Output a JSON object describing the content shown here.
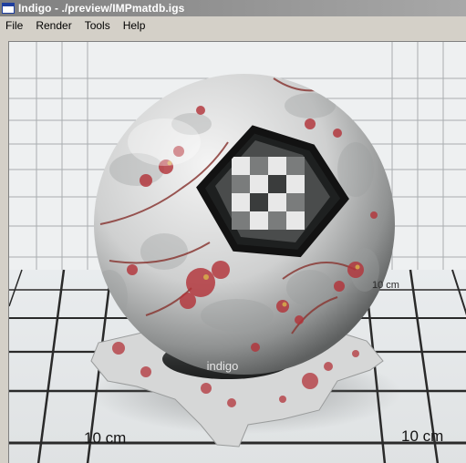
{
  "window": {
    "title": "Indigo - ./preview/IMPmatdb.igs",
    "icon": "app-window-icon"
  },
  "menu": {
    "items": [
      {
        "label": "File"
      },
      {
        "label": "Render"
      },
      {
        "label": "Tools"
      },
      {
        "label": "Help"
      }
    ]
  },
  "render": {
    "scene": "material-preview",
    "pedestal_text": "indigo",
    "dimension_labels": {
      "front_left": "10 cm",
      "front_right": "10 cm",
      "back_right": "10 cm"
    },
    "colors": {
      "backdrop": "#eef0f1",
      "grid_lines": "#2a2a2a",
      "sphere_base": "#d9dada",
      "floral_pattern": "#b2343a"
    }
  }
}
